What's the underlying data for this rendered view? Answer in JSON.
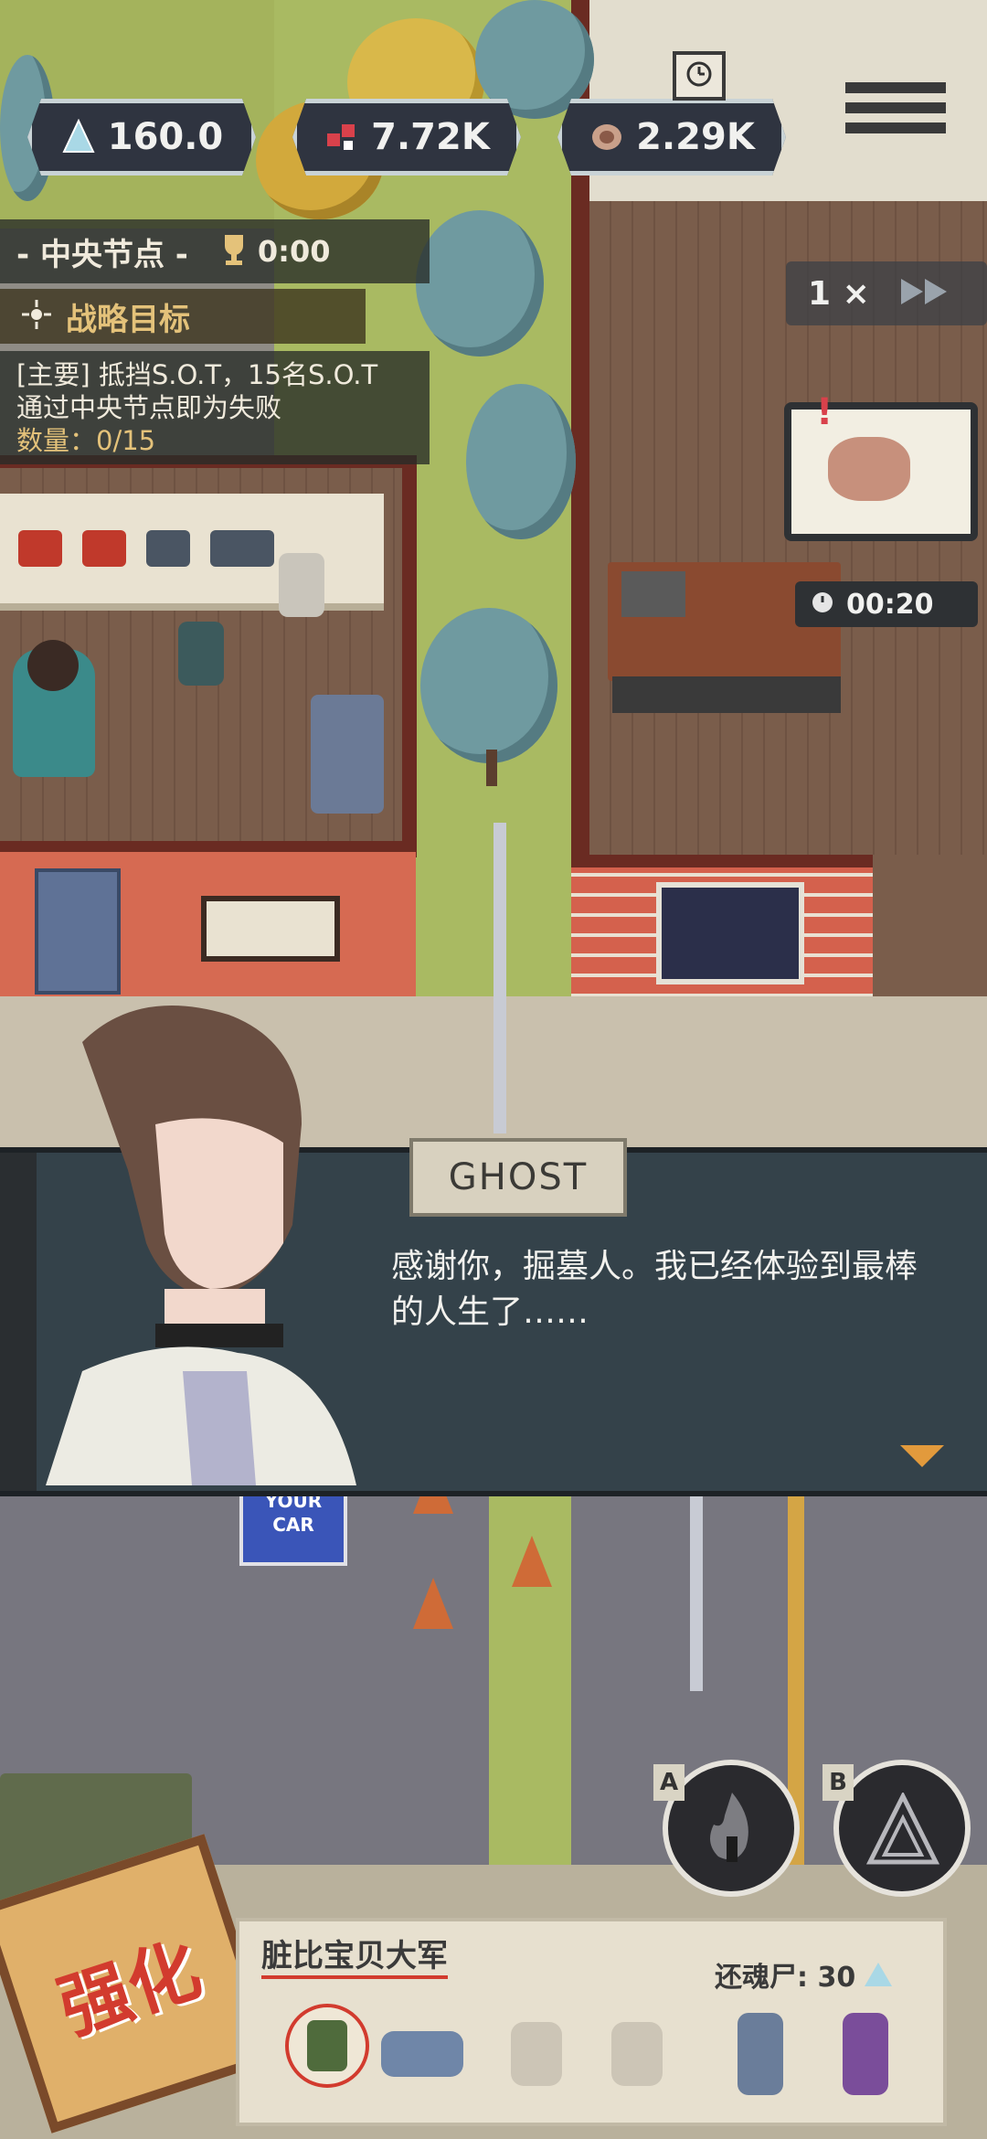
{
  "hud": {
    "crystal_value": "160.0",
    "blood_value": "7.72K",
    "meat_value": "2.29K",
    "speed_label": "1 ×"
  },
  "objective": {
    "node_name": "- 中央节点 -",
    "timer": "0:00",
    "strategy_label": "战略目标",
    "main_line1": "[主要] 抵挡S.O.T，15名S.O.T",
    "main_line2": "通过中央节点即为失败",
    "count_label": "数量：0/15"
  },
  "cooking": {
    "timer": "00:20",
    "alert": "!"
  },
  "dialog": {
    "speaker": "GHOST",
    "line1": "感谢你，掘墓人。我已经体验到最棒",
    "line2": "的人生了……"
  },
  "sign": {
    "text_line1": "YOUR",
    "text_line2": "CAR"
  },
  "skills": {
    "a_label": "A",
    "b_label": "B"
  },
  "upgrade": {
    "label": "强化"
  },
  "squad": {
    "title": "脏比宝贝大军",
    "revive_label": "还魂尸: 30"
  },
  "colors": {
    "hud_bg": "#2f3440",
    "dialog_bg": "#34424a",
    "accent_gold": "#e4c27a",
    "upgrade_red": "#d23b2e"
  },
  "icons": [
    "crystal-icon",
    "blood-drop-icon",
    "meat-icon",
    "trophy-icon",
    "target-icon",
    "menu-icon",
    "clock-icon",
    "fast-forward-icon",
    "timer-icon",
    "fire-skill-icon",
    "pyramid-skill-icon"
  ]
}
